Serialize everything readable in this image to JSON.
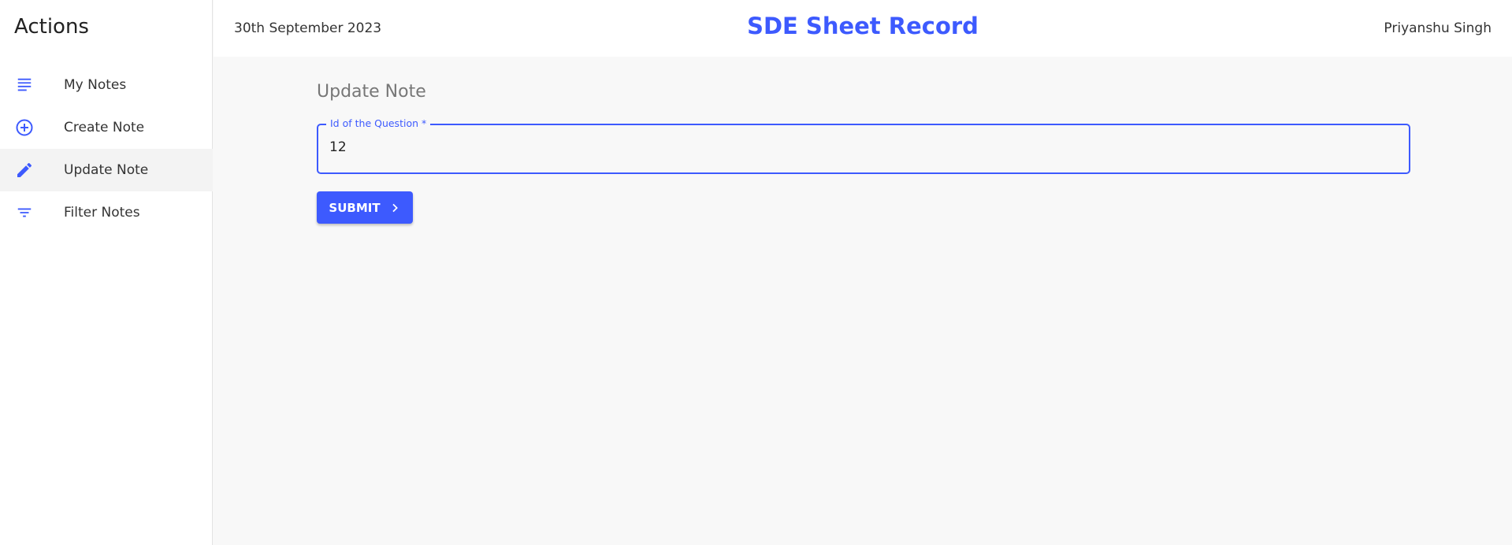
{
  "colors": {
    "accent": "#3d5afe",
    "sidebar_bg": "#ffffff",
    "main_bg": "#f8f8f8"
  },
  "sidebar": {
    "title": "Actions",
    "items": [
      {
        "label": "My Notes",
        "icon": "notes-list-icon",
        "active": false
      },
      {
        "label": "Create Note",
        "icon": "add-circle-icon",
        "active": false
      },
      {
        "label": "Update Note",
        "icon": "pencil-icon",
        "active": true
      },
      {
        "label": "Filter Notes",
        "icon": "filter-icon",
        "active": false
      }
    ]
  },
  "header": {
    "date": "30th September 2023",
    "title": "SDE Sheet Record",
    "user": "Priyanshu Singh"
  },
  "form": {
    "title": "Update Note",
    "field_label": "Id of the Question *",
    "field_value": "12",
    "submit_label": "SUBMIT",
    "submit_icon": "chevron-right-icon"
  }
}
